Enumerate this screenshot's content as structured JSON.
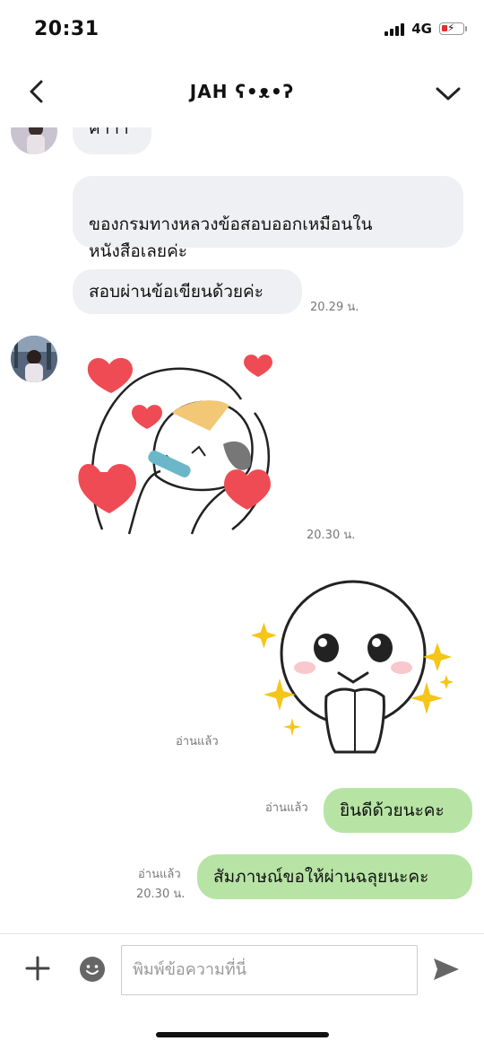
{
  "status": {
    "time": "20:31",
    "network": "4G"
  },
  "header": {
    "title": "JAH ʕ•ᴥ•ʔ"
  },
  "messages": {
    "partial": "ค่าาา",
    "m1": "ของกรมทางหลวงข้อสอบออกเหมือนใน\nหนังสือเลยค่ะ",
    "m2": "สอบผ่านข้อเขียนด้วยค่ะ",
    "m2_time": "20.29 น.",
    "sticker1_time": "20.30 น.",
    "sticker2_read": "อ่านแล้ว",
    "r1_read": "อ่านแล้ว",
    "r1": "ยินดีด้วยนะคะ",
    "r2_read": "อ่านแล้ว",
    "r2_time": "20.30 น.",
    "r2": "สัมภาษณ์ขอให้ผ่านฉลุยนะคะ"
  },
  "composer": {
    "placeholder": "พิมพ์ข้อความที่นี่"
  },
  "colors": {
    "my_bubble": "#b7e4a5",
    "their_bubble": "#eef0f3",
    "heart": "#ef4b55",
    "sparkle": "#f5c518"
  },
  "icons": [
    "back-icon",
    "chevron-down-icon",
    "plus-icon",
    "emoji-icon",
    "send-icon"
  ]
}
